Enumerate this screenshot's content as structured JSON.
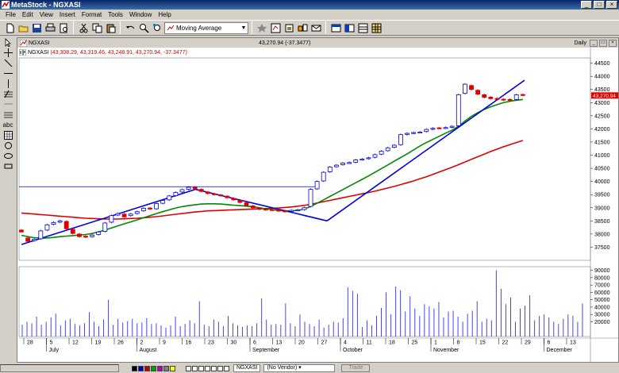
{
  "app": {
    "title": "MetaStock - NGXASI",
    "window_buttons": [
      "_",
      "□",
      "×"
    ]
  },
  "menu": [
    "File",
    "Edit",
    "View",
    "Insert",
    "Format",
    "Tools",
    "Window",
    "Help"
  ],
  "toolbar": {
    "indicator_value": "Moving Average",
    "icons": [
      "new-icon",
      "open-icon",
      "save-icon",
      "print-icon",
      "print-preview-icon",
      "cut-icon",
      "copy-icon",
      "paste-icon",
      "undo-icon",
      "zoom-in-icon",
      "zoom-out-icon",
      "expert-icon",
      "explorer-icon",
      "system-tester-icon",
      "inspector-icon",
      "bar-style-icon",
      "line-style-icon",
      "layout-icon",
      "grid-icon"
    ]
  },
  "left_tools": [
    "pointer-icon",
    "crosshair-icon",
    "trendline-icon",
    "horizontal-line-icon",
    "vertical-line-icon",
    "fibonacci-icon",
    "channel-icon",
    "text-icon",
    "grid-tool-icon",
    "ellipse-icon",
    "ellipse2-icon",
    "rectangle-icon"
  ],
  "chart": {
    "window_title": "NGXASI",
    "last_price_header": "43,270.94 (-37.3477)",
    "periodicity": "Daily",
    "legend_name": "NGXASI",
    "legend_ohlc": "(43,308.29, 43,319.46, 43,248.91, 43,270.94, -37.3477)",
    "last_price_label": "43,270.94",
    "colors": {
      "up": "#0000e0",
      "down": "#e00000",
      "ma_short": "#008a00",
      "ma_long": "#e00000",
      "trend": "#0000e0",
      "volume": "#3030ff"
    }
  },
  "price_axis": [
    "44500",
    "44000",
    "43500",
    "43000",
    "42500",
    "42000",
    "41500",
    "41000",
    "40500",
    "40000",
    "39500",
    "39000",
    "38500",
    "38000",
    "37500"
  ],
  "volume_axis": [
    "90000",
    "80000",
    "70000",
    "60000",
    "50000",
    "40000",
    "30000",
    "20000"
  ],
  "date_axis": {
    "days": [
      "28",
      "5",
      "12",
      "19",
      "26",
      "2",
      "9",
      "16",
      "23",
      "30",
      "6",
      "13",
      "20",
      "27",
      "4",
      "11",
      "18",
      "25",
      "1",
      "8",
      "15",
      "22",
      "29",
      "6",
      "13"
    ],
    "months": [
      "July",
      "August",
      "September",
      "October",
      "November",
      "December"
    ]
  },
  "chart_data": {
    "type": "candlestick",
    "ylim": [
      37000,
      44700
    ],
    "volume_ylim": [
      0,
      95000
    ],
    "close": [
      38080,
      37720,
      37800,
      38120,
      38350,
      38440,
      38500,
      38200,
      38020,
      37900,
      37880,
      37960,
      38080,
      38420,
      38700,
      38780,
      38650,
      38760,
      38850,
      38980,
      38950,
      39160,
      39280,
      39450,
      39580,
      39690,
      39780,
      39720,
      39620,
      39540,
      39500,
      39460,
      39380,
      39300,
      39200,
      39080,
      39000,
      38940,
      38920,
      38900,
      38880,
      38860,
      38900,
      38920,
      39000,
      39700,
      40000,
      40350,
      40550,
      40620,
      40700,
      40720,
      40820,
      40850,
      40900,
      41020,
      41150,
      41280,
      41380,
      41780,
      41830,
      41860,
      41880,
      41980,
      42020,
      42030,
      42050,
      42100,
      43300,
      43700,
      43500,
      43320,
      43200,
      43150,
      43120,
      43110,
      43100,
      43300,
      43270.94
    ],
    "open": [
      38150,
      37850,
      37750,
      37820,
      38150,
      38370,
      38450,
      38480,
      38180,
      38000,
      37920,
      37900,
      37980,
      38100,
      38450,
      38720,
      38760,
      38700,
      38780,
      38880,
      38990,
      38960,
      39170,
      39300,
      39460,
      39600,
      39700,
      39780,
      39700,
      39600,
      39530,
      39490,
      39440,
      39360,
      39280,
      39190,
      39070,
      38990,
      38950,
      38930,
      38910,
      38880,
      38860,
      38900,
      38930,
      39050,
      39720,
      40020,
      40370,
      40560,
      40640,
      40710,
      40730,
      40830,
      40870,
      40920,
      41040,
      41170,
      41300,
      41400,
      41790,
      41840,
      41870,
      41900,
      41990,
      42040,
      42040,
      42060,
      42120,
      43350,
      43650,
      43470,
      43300,
      43210,
      43160,
      43130,
      43120,
      43120,
      43308.29
    ],
    "volume": [
      16000,
      20000,
      18000,
      27000,
      16000,
      20000,
      26000,
      31000,
      15000,
      22000,
      24000,
      17000,
      15000,
      18000,
      33000,
      20000,
      14000,
      23000,
      50000,
      16000,
      24000,
      19000,
      21000,
      24000,
      18000,
      19000,
      25000,
      17000,
      18000,
      15000,
      12000,
      15000,
      27000,
      14000,
      17000,
      22000,
      18000,
      48000,
      16000,
      14000,
      23000,
      20000,
      14000,
      28000,
      18000,
      15000,
      13000,
      15000,
      14000,
      18000,
      52000,
      23000,
      16000,
      17000,
      16000,
      45000,
      18000,
      14000,
      30000,
      20000,
      17000,
      14000,
      23000,
      12000,
      16000,
      20000,
      19000,
      25000,
      67000,
      62000,
      58000,
      13000,
      22000,
      15000,
      28000,
      39000,
      60000,
      30000,
      68000,
      63000,
      34000,
      55000,
      38000,
      28000,
      44000,
      41000,
      38000,
      47000,
      26000,
      34000,
      35000,
      27000,
      20000,
      31000,
      35000,
      48000,
      20000,
      24000,
      22000,
      90000,
      65000,
      44000,
      53000,
      20000,
      38000,
      42000,
      56000,
      22000,
      28000,
      30000,
      26000,
      20000,
      17000,
      24000,
      30000,
      28000,
      20000,
      45000
    ],
    "ma_short": [
      37950,
      37900,
      37860,
      37850,
      37850,
      37870,
      37900,
      37920,
      37940,
      37960,
      37980,
      38020,
      38080,
      38150,
      38230,
      38310,
      38390,
      38460,
      38540,
      38620,
      38700,
      38780,
      38850,
      38920,
      38990,
      39040,
      39080,
      39110,
      39140,
      39150,
      39150,
      39140,
      39120,
      39100,
      39080,
      39060,
      39040,
      39000,
      38960,
      38930,
      38900,
      38880,
      38880,
      38900,
      38950,
      39050,
      39170,
      39300,
      39430,
      39560,
      39690,
      39820,
      39950,
      40080,
      40210,
      40350,
      40490,
      40630,
      40770,
      40910,
      41050,
      41200,
      41350,
      41480,
      41600,
      41720,
      41840,
      41950,
      42100,
      42300,
      42480,
      42620,
      42740,
      42840,
      42920,
      43000,
      43050,
      43090,
      43120
    ],
    "ma_long": [
      38800,
      38780,
      38760,
      38740,
      38720,
      38700,
      38680,
      38660,
      38640,
      38620,
      38600,
      38590,
      38580,
      38570,
      38570,
      38570,
      38580,
      38590,
      38600,
      38620,
      38640,
      38660,
      38690,
      38720,
      38750,
      38780,
      38810,
      38840,
      38860,
      38880,
      38890,
      38900,
      38910,
      38920,
      38930,
      38940,
      38950,
      38960,
      38970,
      38980,
      38990,
      39010,
      39030,
      39060,
      39090,
      39130,
      39180,
      39230,
      39280,
      39330,
      39380,
      39430,
      39480,
      39530,
      39580,
      39630,
      39690,
      39750,
      39810,
      39880,
      39950,
      40020,
      40100,
      40180,
      40270,
      40360,
      40450,
      40540,
      40640,
      40740,
      40840,
      40940,
      41040,
      41140,
      41230,
      41320,
      41400,
      41480,
      41560
    ],
    "trendlines": [
      {
        "x": [
          0,
          37
        ],
        "y": [
          37600,
          39700
        ]
      },
      {
        "x": [
          37,
          65
        ],
        "y": [
          39700,
          38500
        ]
      },
      {
        "x": [
          65,
          107
        ],
        "y": [
          38500,
          43850
        ]
      }
    ],
    "horizontal_line": {
      "y": 39800
    }
  }
}
